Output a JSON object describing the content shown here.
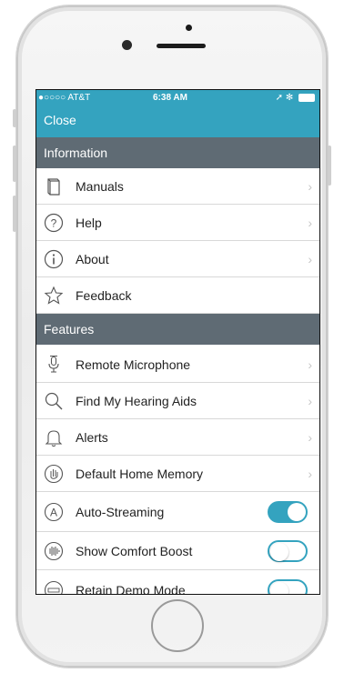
{
  "status": {
    "carrier": "●○○○○ AT&T",
    "time": "6:38 AM",
    "right": "➚ ✻"
  },
  "nav": {
    "close": "Close"
  },
  "sections": {
    "information": "Information",
    "features": "Features"
  },
  "information_items": [
    {
      "label": "Manuals",
      "icon": "book-icon"
    },
    {
      "label": "Help",
      "icon": "question-icon"
    },
    {
      "label": "About",
      "icon": "info-icon"
    },
    {
      "label": "Feedback",
      "icon": "star-icon"
    }
  ],
  "features_items": [
    {
      "label": "Remote Microphone",
      "icon": "microphone-icon"
    },
    {
      "label": "Find My Hearing Aids",
      "icon": "search-icon"
    },
    {
      "label": "Alerts",
      "icon": "bell-icon"
    },
    {
      "label": "Default Home Memory",
      "icon": "hand-icon"
    },
    {
      "label": "Auto-Streaming",
      "icon": "stream-icon",
      "toggle": true
    },
    {
      "label": "Show Comfort Boost",
      "icon": "boost-icon",
      "toggle": false
    },
    {
      "label": "Retain Demo Mode",
      "icon": "demo-icon",
      "toggle": false
    }
  ],
  "chevron": "›",
  "colors": {
    "accent": "#34a3bf",
    "section": "#5f6b74"
  }
}
